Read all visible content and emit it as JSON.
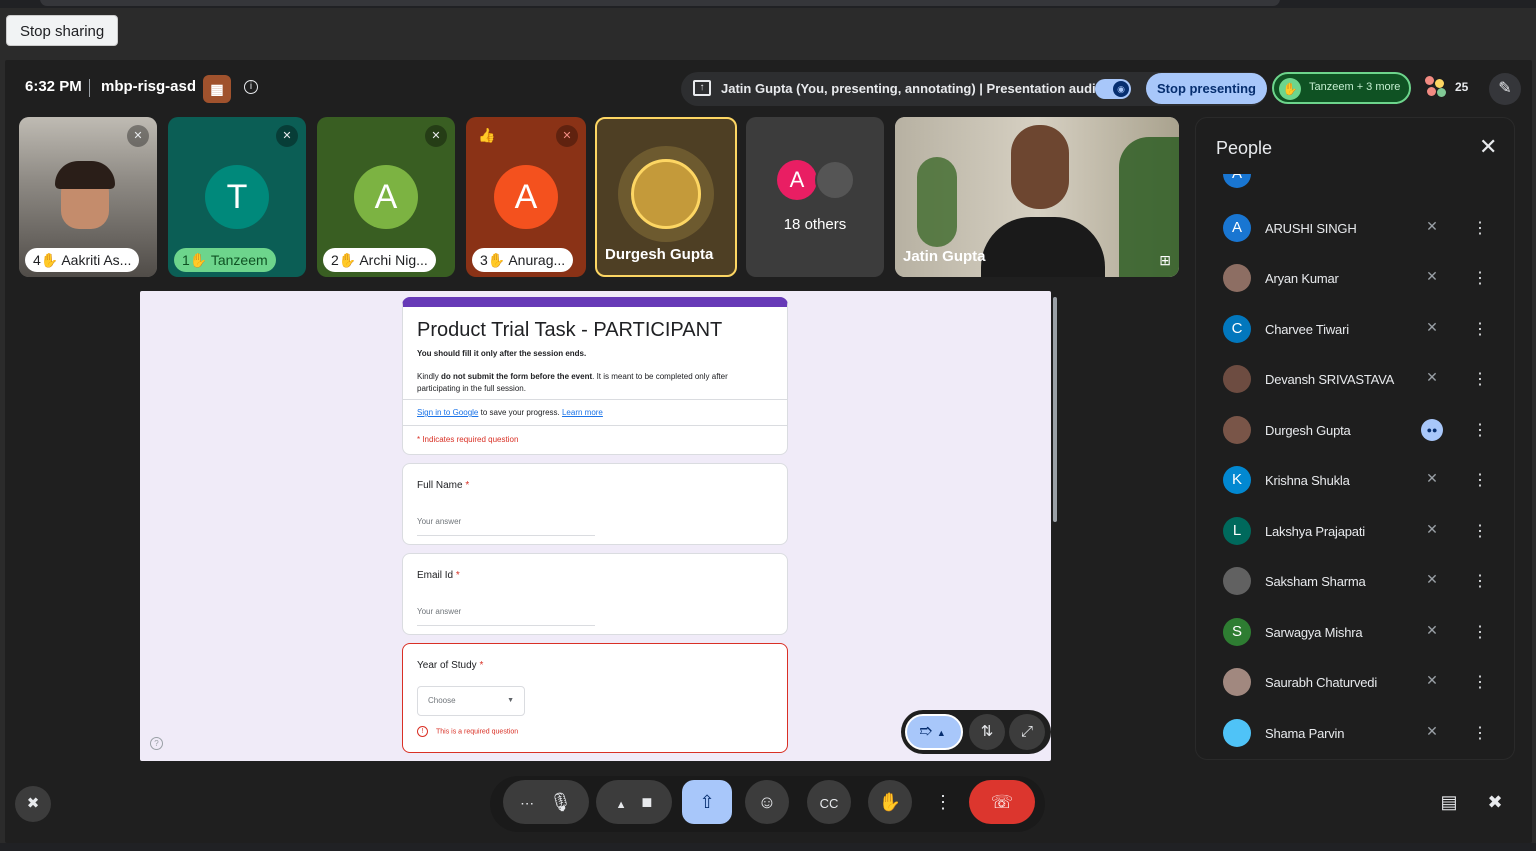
{
  "browser": {
    "stop_sharing_label": "Stop sharing"
  },
  "header": {
    "time": "6:32 PM",
    "meeting_code": "mbp-risg-asd",
    "presenting_text": "Jatin Gupta (You, presenting, annotating)  |  Presentation audio",
    "stop_presenting_label": "Stop presenting",
    "raised_hands_label": "Tanzeem + 3 more",
    "participant_count": "25"
  },
  "tiles": [
    {
      "name": "4✋ Aakriti As...",
      "style": "white"
    },
    {
      "name": "1✋ Tanzeem",
      "initial": "T",
      "avatar_color": "#00897b",
      "style": "green"
    },
    {
      "name": "2✋ Archi Nig...",
      "initial": "A",
      "avatar_color": "#7cb342",
      "style": "white"
    },
    {
      "name": "3✋ Anurag...",
      "initial": "A",
      "avatar_color": "#f4511e",
      "style": "white"
    },
    {
      "name": "Durgesh Gupta",
      "style": "plain"
    },
    {
      "others_label": "18 others",
      "initial": "A",
      "avatar_color": "#e91e63"
    },
    {
      "name": "Jatin Gupta",
      "style": "plain"
    }
  ],
  "form": {
    "title": "Product Trial Task - PARTICIPANT",
    "note_bold": "You should fill it only after the session ends.",
    "desc_pre": "Kindly ",
    "desc_bold": "do not submit the form before the event",
    "desc_post": ". It is meant to be completed only after participating in the full session.",
    "signin_link": "Sign in to Google",
    "signin_text": " to save your progress. ",
    "learn_more": "Learn more",
    "required_note": "* Indicates required question",
    "q1_label": "Full Name",
    "q1_placeholder": "Your answer",
    "q2_label": "Email Id",
    "q2_placeholder": "Your answer",
    "q3_label": "Year of Study",
    "q3_select": "Choose",
    "q3_error": "This is a required question",
    "asterisk": " *"
  },
  "people": {
    "title": "People",
    "rows": [
      {
        "name": "ARUSHI SINGH",
        "initial": "A",
        "color": "#1976d2",
        "type": "letter"
      },
      {
        "name": "Aryan Kumar",
        "initial": "",
        "color": "#8d6e63",
        "type": "photo"
      },
      {
        "name": "Charvee Tiwari",
        "initial": "C",
        "color": "#0277bd",
        "type": "letter"
      },
      {
        "name": "Devansh SRIVASTAVA",
        "initial": "",
        "color": "#6d4c41",
        "type": "photo"
      },
      {
        "name": "Durgesh Gupta",
        "initial": "",
        "color": "#795548",
        "type": "photo",
        "speaking": true
      },
      {
        "name": "Krishna Shukla",
        "initial": "K",
        "color": "#0288d1",
        "type": "letter"
      },
      {
        "name": "Lakshya Prajapati",
        "initial": "L",
        "color": "#00695c",
        "type": "letter"
      },
      {
        "name": "Saksham Sharma",
        "initial": "",
        "color": "#616161",
        "type": "photo"
      },
      {
        "name": "Sarwagya Mishra",
        "initial": "S",
        "color": "#2e7d32",
        "type": "letter"
      },
      {
        "name": "Saurabh Chaturvedi",
        "initial": "",
        "color": "#a1887f",
        "type": "photo"
      },
      {
        "name": "Shama Parvin",
        "initial": "",
        "color": "#4fc3f7",
        "type": "photo"
      }
    ]
  }
}
